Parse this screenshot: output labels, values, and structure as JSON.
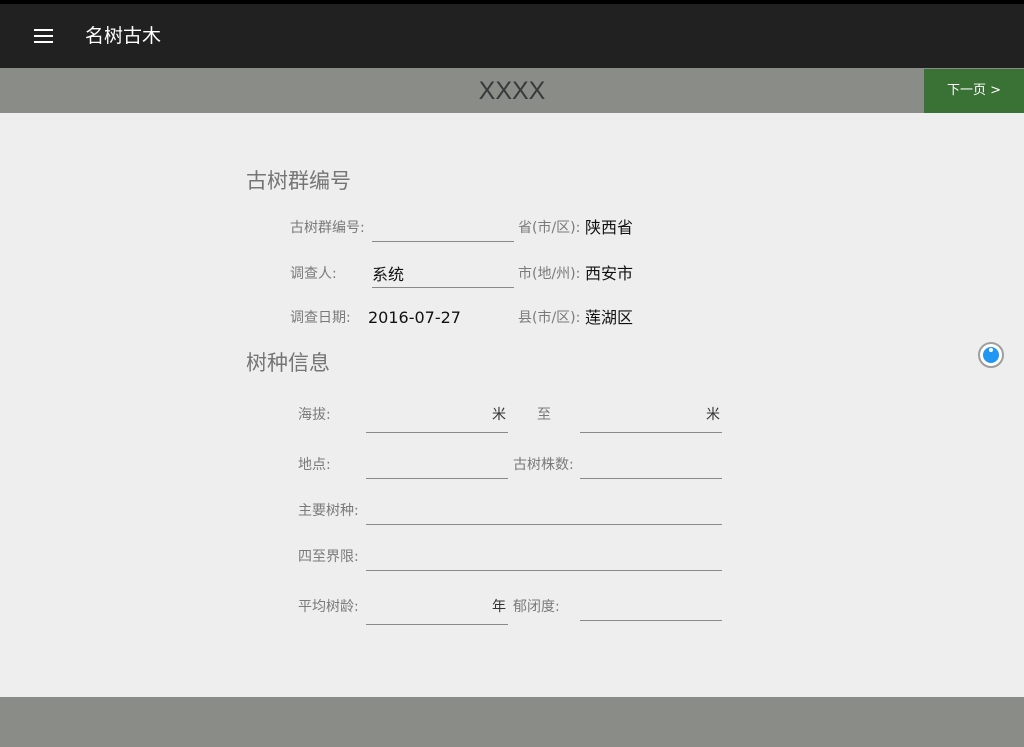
{
  "app": {
    "title": "名树古木"
  },
  "subheader": {
    "title": "XXXX",
    "next_label": "下一页 >"
  },
  "section1": {
    "title": "古树群编号",
    "group_no_label": "古树群编号:",
    "group_no_value": "",
    "province_label": "省(市/区):",
    "province_value": "陕西省",
    "investigator_label": "调查人:",
    "investigator_value": "系统",
    "city_label": "市(地/州):",
    "city_value": "西安市",
    "date_label": "调查日期:",
    "date_value": "2016-07-27",
    "county_label": "县(市/区):",
    "county_value": "莲湖区"
  },
  "section2": {
    "title": "树种信息",
    "altitude_label": "海拔:",
    "altitude_from": "",
    "altitude_unit": "米",
    "to_label": "至",
    "altitude_to": "",
    "altitude_to_unit": "米",
    "location_label": "地点:",
    "location_value": "",
    "tree_count_label": "古树株数:",
    "tree_count_value": "",
    "main_species_label": "主要树种:",
    "main_species_value": "",
    "boundary_label": "四至界限:",
    "boundary_value": "",
    "avg_age_label": "平均树龄:",
    "avg_age_value": "",
    "avg_age_unit": "年",
    "canopy_label": "郁闭度:",
    "canopy_value": ""
  },
  "colors": {
    "appbar": "#212121",
    "subheader": "#8a8c88",
    "next_button": "#3a7135",
    "fab": "#2196f3"
  }
}
